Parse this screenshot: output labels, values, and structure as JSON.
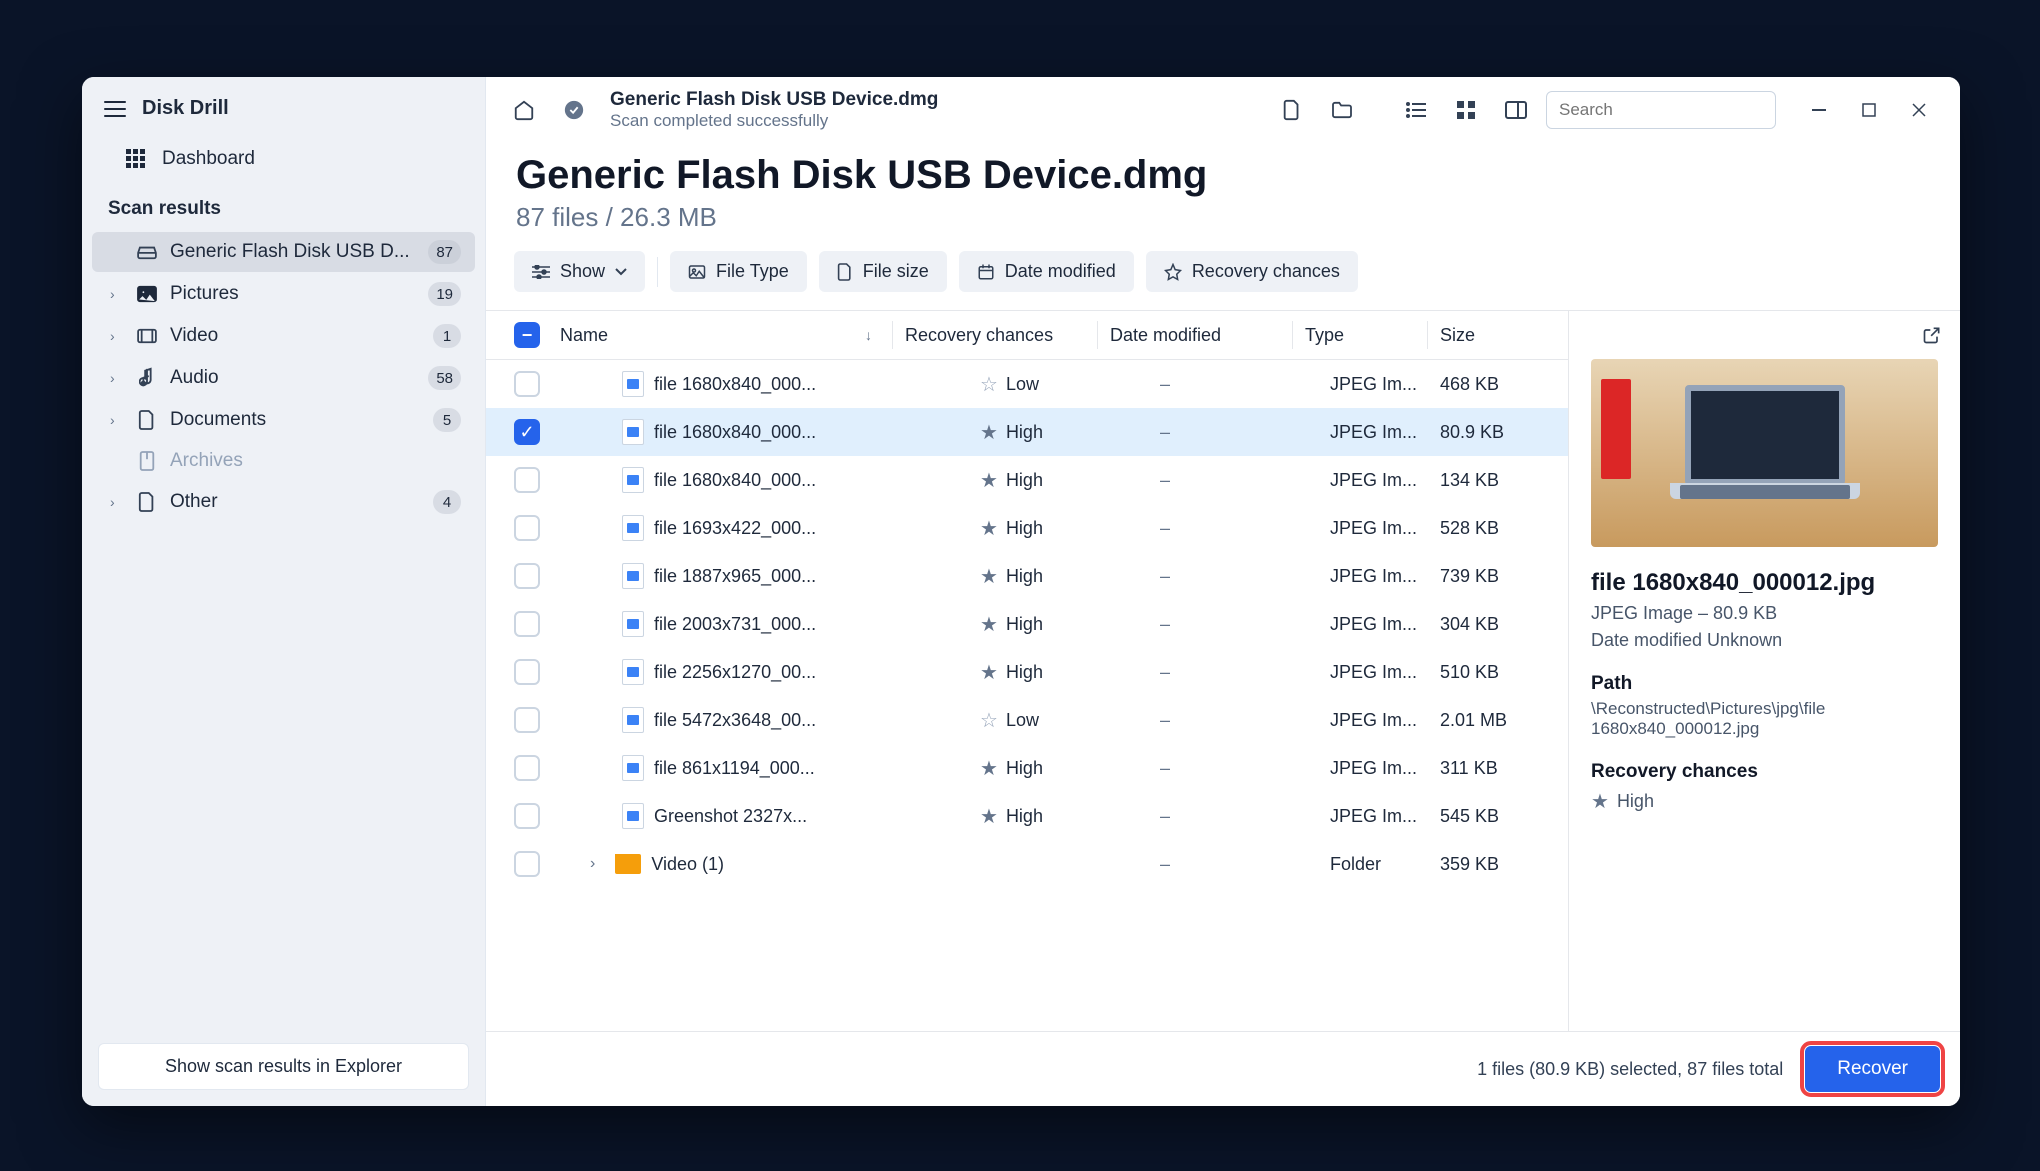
{
  "app": {
    "name": "Disk Drill"
  },
  "sidebar": {
    "dashboard": "Dashboard",
    "section_label": "Scan results",
    "items": [
      {
        "label": "Generic Flash Disk USB D...",
        "count": "87",
        "icon": "drive",
        "selected": true,
        "expandable": false
      },
      {
        "label": "Pictures",
        "count": "19",
        "icon": "image",
        "expandable": true
      },
      {
        "label": "Video",
        "count": "1",
        "icon": "video",
        "expandable": true
      },
      {
        "label": "Audio",
        "count": "58",
        "icon": "audio",
        "expandable": true
      },
      {
        "label": "Documents",
        "count": "5",
        "icon": "document",
        "expandable": true
      },
      {
        "label": "Archives",
        "count": "",
        "icon": "archive",
        "muted": true,
        "expandable": false
      },
      {
        "label": "Other",
        "count": "4",
        "icon": "other",
        "expandable": true
      }
    ],
    "explorer_btn": "Show scan results in Explorer"
  },
  "topbar": {
    "title": "Generic Flash Disk USB Device.dmg",
    "subtitle": "Scan completed successfully",
    "search_placeholder": "Search"
  },
  "heading": {
    "title": "Generic Flash Disk USB Device.dmg",
    "subtitle": "87 files / 26.3 MB"
  },
  "filters": {
    "show": "Show",
    "file_type": "File Type",
    "file_size": "File size",
    "date_modified": "Date modified",
    "recovery_chances": "Recovery chances"
  },
  "columns": {
    "name": "Name",
    "recovery": "Recovery chances",
    "date": "Date modified",
    "type": "Type",
    "size": "Size"
  },
  "rows": [
    {
      "name": "file 1680x840_000...",
      "recovery": "Low",
      "star": "outline",
      "date": "–",
      "type": "JPEG Im...",
      "size": "468 KB",
      "checked": false
    },
    {
      "name": "file 1680x840_000...",
      "recovery": "High",
      "star": "solid",
      "date": "–",
      "type": "JPEG Im...",
      "size": "80.9 KB",
      "checked": true,
      "selected": true
    },
    {
      "name": "file 1680x840_000...",
      "recovery": "High",
      "star": "solid",
      "date": "–",
      "type": "JPEG Im...",
      "size": "134 KB",
      "checked": false
    },
    {
      "name": "file 1693x422_000...",
      "recovery": "High",
      "star": "solid",
      "date": "–",
      "type": "JPEG Im...",
      "size": "528 KB",
      "checked": false
    },
    {
      "name": "file 1887x965_000...",
      "recovery": "High",
      "star": "solid",
      "date": "–",
      "type": "JPEG Im...",
      "size": "739 KB",
      "checked": false
    },
    {
      "name": "file 2003x731_000...",
      "recovery": "High",
      "star": "solid",
      "date": "–",
      "type": "JPEG Im...",
      "size": "304 KB",
      "checked": false
    },
    {
      "name": "file 2256x1270_00...",
      "recovery": "High",
      "star": "solid",
      "date": "–",
      "type": "JPEG Im...",
      "size": "510 KB",
      "checked": false
    },
    {
      "name": "file 5472x3648_00...",
      "recovery": "Low",
      "star": "outline",
      "date": "–",
      "type": "JPEG Im...",
      "size": "2.01 MB",
      "checked": false
    },
    {
      "name": "file 861x1194_000...",
      "recovery": "High",
      "star": "solid",
      "date": "–",
      "type": "JPEG Im...",
      "size": "311 KB",
      "checked": false
    },
    {
      "name": "Greenshot 2327x...",
      "recovery": "High",
      "star": "solid",
      "date": "–",
      "type": "JPEG Im...",
      "size": "545 KB",
      "checked": false
    },
    {
      "name": "Video (1)",
      "recovery": "",
      "star": "",
      "date": "–",
      "type": "Folder",
      "size": "359 KB",
      "checked": false,
      "folder": true
    }
  ],
  "details": {
    "filename": "file 1680x840_000012.jpg",
    "type_size": "JPEG Image – 80.9 KB",
    "date_modified": "Date modified Unknown",
    "path_label": "Path",
    "path_value": "\\Reconstructed\\Pictures\\jpg\\file 1680x840_000012.jpg",
    "recovery_label": "Recovery chances",
    "recovery_value": "High"
  },
  "footer": {
    "summary": "1 files (80.9 KB) selected, 87 files total",
    "recover": "Recover"
  }
}
